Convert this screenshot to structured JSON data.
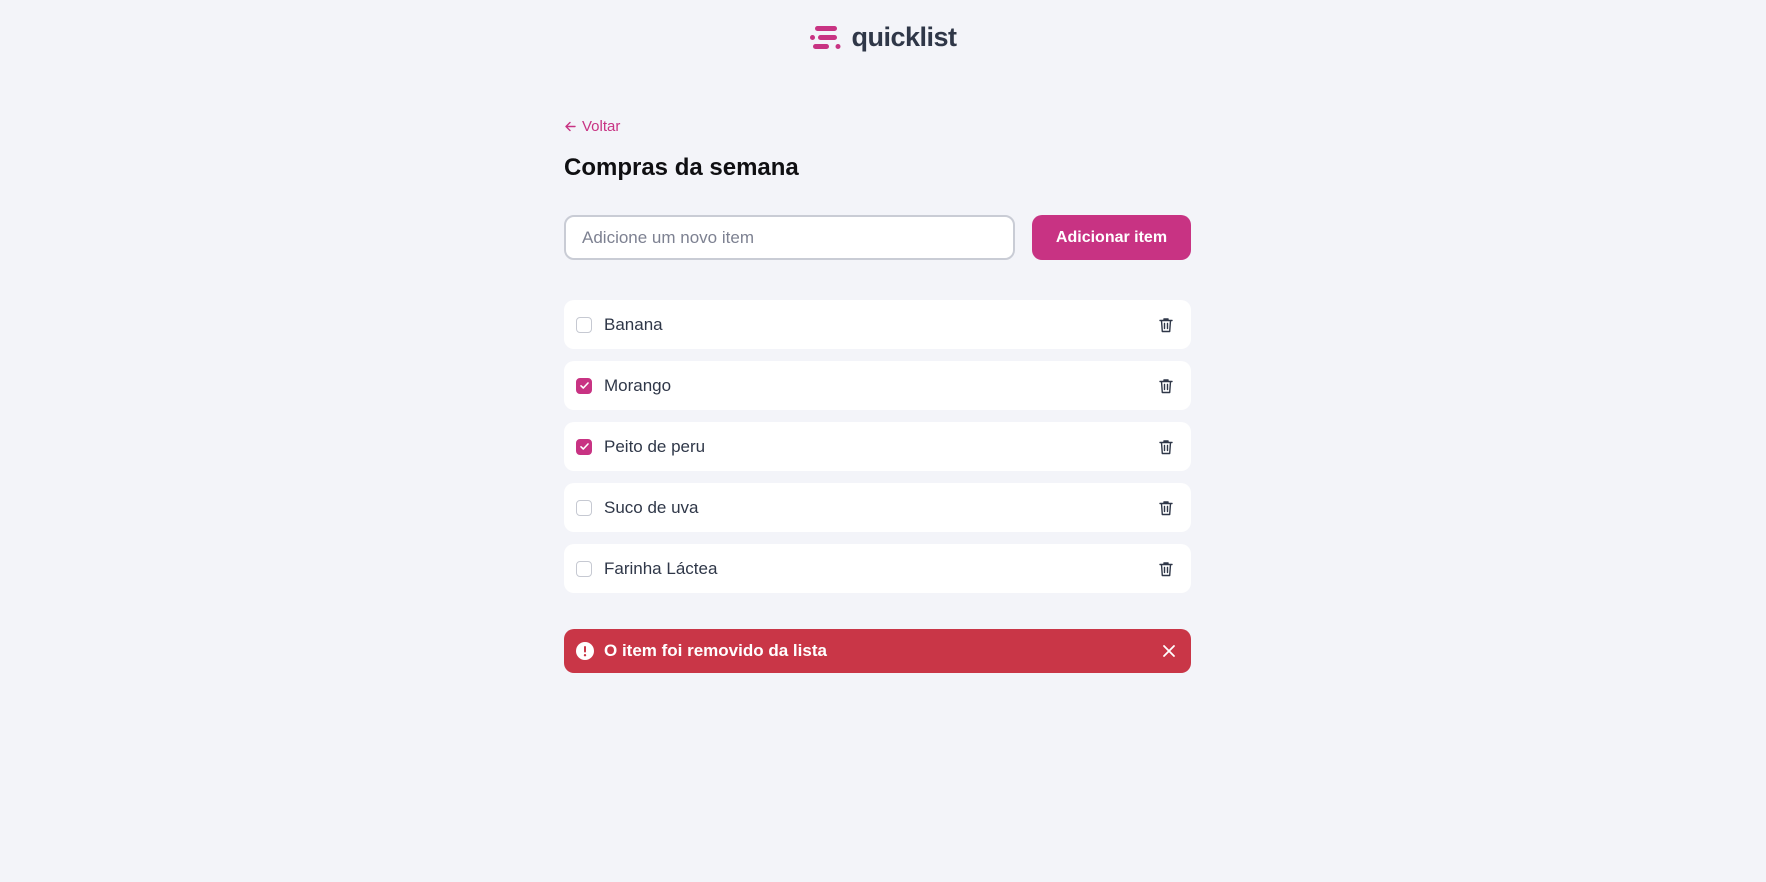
{
  "header": {
    "logo_text": "quicklist",
    "logo_icon": "list-lines-icon"
  },
  "nav": {
    "back_label": "Voltar",
    "back_icon": "arrow-left-icon"
  },
  "page": {
    "title": "Compras da semana"
  },
  "add_form": {
    "input_value": "",
    "input_placeholder": "Adicione um novo item",
    "button_label": "Adicionar item"
  },
  "items": [
    {
      "label": "Banana",
      "checked": false
    },
    {
      "label": "Morango",
      "checked": true
    },
    {
      "label": "Peito de peru",
      "checked": true
    },
    {
      "label": "Suco de uva",
      "checked": false
    },
    {
      "label": "Farinha Láctea",
      "checked": false
    }
  ],
  "toast": {
    "message": "O item foi removido da lista",
    "icon": "alert-circle-icon",
    "close_icon": "close-icon"
  },
  "colors": {
    "accent": "#c83383",
    "background": "#f3f4f9",
    "toast_bg": "#c93647",
    "text": "#2f3748"
  }
}
